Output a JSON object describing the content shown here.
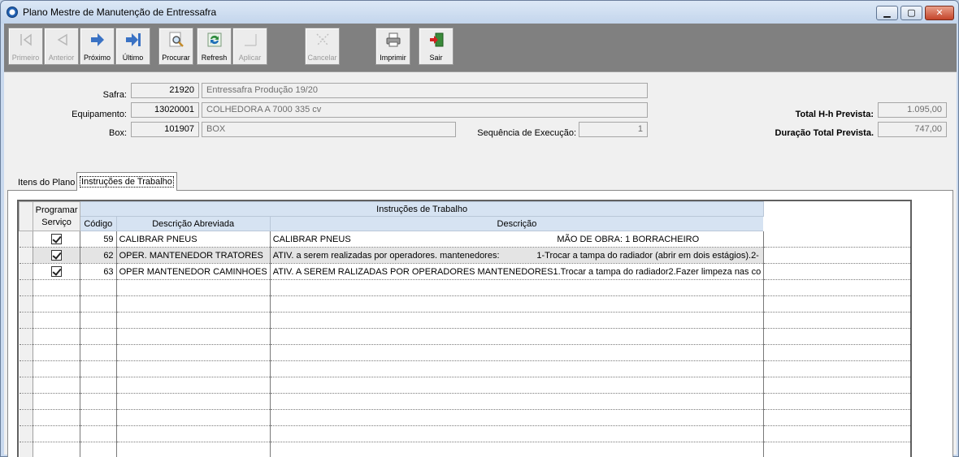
{
  "window": {
    "title": "Plano Mestre de Manutenção de Entressafra"
  },
  "toolbar": {
    "primeiro": "Primeiro",
    "anterior": "Anterior",
    "proximo": "Próximo",
    "ultimo": "Último",
    "procurar": "Procurar",
    "refresh": "Refresh",
    "aplicar": "Aplicar",
    "cancelar": "Cancelar",
    "imprimir": "Imprimir",
    "sair": "Sair"
  },
  "form": {
    "safra_label": "Safra:",
    "safra_code": "21920",
    "safra_desc": "Entressafra Produção 19/20",
    "equip_label": "Equipamento:",
    "equip_code": "13020001",
    "equip_desc": "COLHEDORA A 7000 335 cv",
    "box_label": "Box:",
    "box_code": "101907",
    "box_desc": "BOX",
    "seq_label": "Sequência de Execução:",
    "seq_value": "1",
    "total_hh_label": "Total H-h Prevista:",
    "total_hh_value": "1.095,00",
    "duracao_label": "Duração Total Prevista.",
    "duracao_value": "747,00"
  },
  "tabs": [
    {
      "label": "Itens do Plano"
    },
    {
      "label": "Instruções de Trabalho"
    }
  ],
  "grid": {
    "group_header": "Instruções de Trabalho",
    "col_programar_1": "Programar",
    "col_programar_2": "Serviço",
    "col_codigo": "Código",
    "col_desc_abrev": "Descrição Abreviada",
    "col_descricao": "Descrição",
    "rows": [
      {
        "checked": true,
        "codigo": "59",
        "desc_abrev": "CALIBRAR PNEUS",
        "descricao": "CALIBRAR PNEUS                                                                                   MÃO DE OBRA: 1 BORRACHEIRO"
      },
      {
        "checked": true,
        "codigo": "62",
        "desc_abrev": "OPER. MANTENEDOR TRATORES",
        "descricao": "ATIV. a serem realizadas por operadores. mantenedores:               1-Trocar a tampa do radiador (abrir em dois estágios).2-"
      },
      {
        "checked": true,
        "codigo": "63",
        "desc_abrev": "OPER MANTENEDOR CAMINHOES",
        "descricao": "ATIV. A SEREM RALIZADAS POR OPERADORES MANTENEDORES1.Trocar a tampa do radiador2.Fazer limpeza nas co"
      }
    ]
  }
}
